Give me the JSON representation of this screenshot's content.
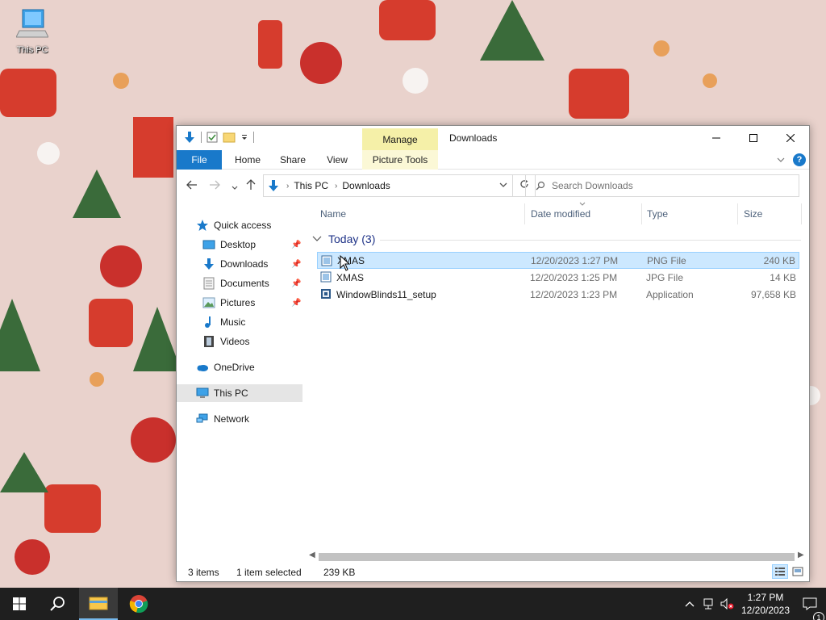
{
  "desktop": {
    "icons": [
      {
        "label": "This PC",
        "icon": "this-pc-icon"
      }
    ]
  },
  "window": {
    "title": "Downloads",
    "contextual_tab": "Manage",
    "ribbon_tabs": [
      "File",
      "Home",
      "Share",
      "View",
      "Picture Tools"
    ],
    "address": {
      "crumbs": [
        "This PC",
        "Downloads"
      ]
    },
    "search": {
      "placeholder": "Search Downloads"
    },
    "nav": {
      "quick_access": "Quick access",
      "quick_items": [
        "Desktop",
        "Downloads",
        "Documents",
        "Pictures",
        "Music",
        "Videos"
      ],
      "onedrive": "OneDrive",
      "this_pc": "This PC",
      "network": "Network"
    },
    "columns": [
      "Name",
      "Date modified",
      "Type",
      "Size"
    ],
    "group": {
      "label": "Today (3)"
    },
    "files": [
      {
        "name": "XMAS",
        "date": "12/20/2023 1:27 PM",
        "type": "PNG File",
        "size": "240 KB",
        "selected": true
      },
      {
        "name": "XMAS",
        "date": "12/20/2023 1:25 PM",
        "type": "JPG File",
        "size": "14 KB",
        "selected": false
      },
      {
        "name": "WindowBlinds11_setup",
        "date": "12/20/2023 1:23 PM",
        "type": "Application",
        "size": "97,658 KB",
        "selected": false
      }
    ],
    "status": {
      "items": "3 items",
      "selection": "1 item selected",
      "selection_size": "239 KB"
    }
  },
  "taskbar": {
    "time": "1:27 PM",
    "date": "12/20/2023",
    "notification_count": "1"
  },
  "colors": {
    "accent": "#1979ca",
    "manage": "#f5f0a8",
    "selection": "#cce8ff"
  }
}
